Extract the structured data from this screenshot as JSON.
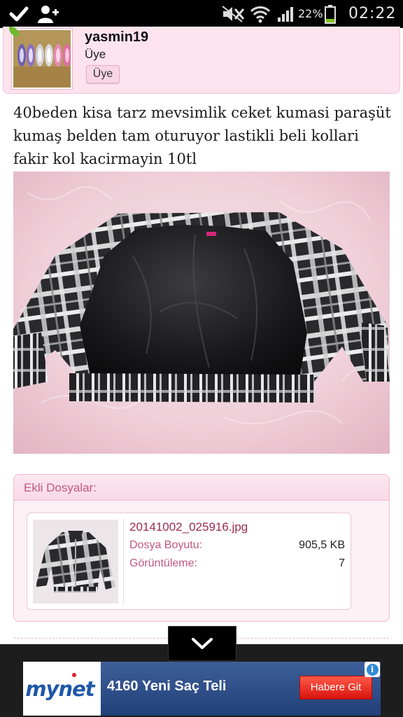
{
  "status_bar": {
    "battery_percent": "22%",
    "time": "02:22",
    "icons": [
      "checkmark-icon",
      "add-contact-icon",
      "silent-mode-icon",
      "wifi-icon",
      "signal-icon",
      "battery-icon"
    ]
  },
  "user": {
    "username": "yasmin19",
    "role_text": "Üye",
    "role_badge": "Üye",
    "avatar_icon": "sneakers-photo"
  },
  "post": {
    "text": "40beden kisa tarz mevsimlik ceket kumasi paraşüt kumaş belden tam oturuyor lastikli beli kollari fakir kol kacirmayin 10tl",
    "image": "plaid-jacket-photo"
  },
  "attachments": {
    "header": "Ekli Dosyalar:",
    "files": [
      {
        "name": "20141002_025916.jpg",
        "size_label": "Dosya Boyutu:",
        "size_value": "905,5 KB",
        "views_label": "Görüntüleme:",
        "views_value": "7"
      }
    ]
  },
  "ad": {
    "brand": "mynet",
    "title": "4160 Yeni Saç Teli",
    "cta": "Habere Git",
    "info_icon": "i"
  },
  "colors": {
    "accent_pink": "#c2577f",
    "card_pink": "#fce3ee",
    "ad_red": "#d8140d",
    "ad_blue": "#22407a"
  }
}
